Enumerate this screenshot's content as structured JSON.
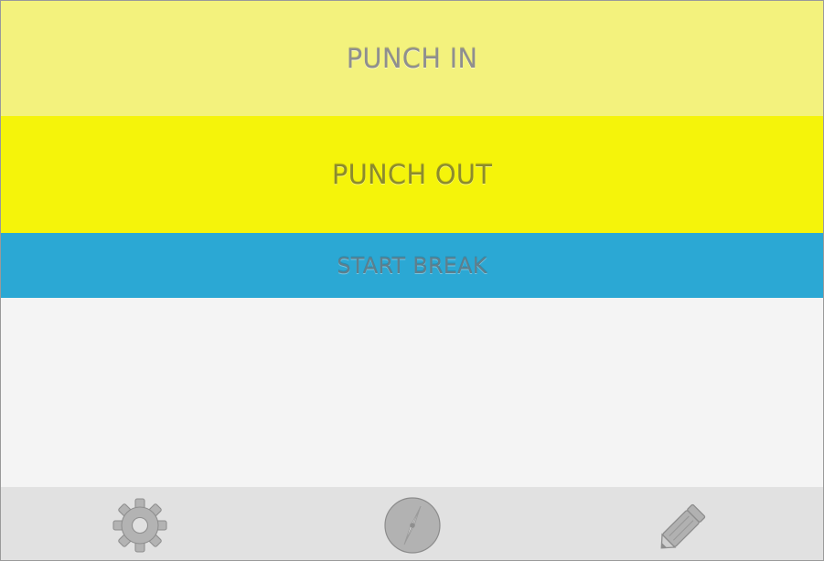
{
  "actions": {
    "punch_in": "PUNCH IN",
    "punch_out": "PUNCH OUT",
    "start_break": "START BREAK"
  },
  "tabbar": {
    "items": [
      {
        "icon": "settings-icon"
      },
      {
        "icon": "compass-icon"
      },
      {
        "icon": "edit-icon"
      }
    ]
  },
  "colors": {
    "punch_in_background": "#f3f27d",
    "punch_out_background": "#f5f40a",
    "start_break_background": "#2ba8d4",
    "content_background": "#f4f4f4",
    "tabbar_background": "#e1e1e1",
    "icon_color": "#b2b2b2"
  }
}
